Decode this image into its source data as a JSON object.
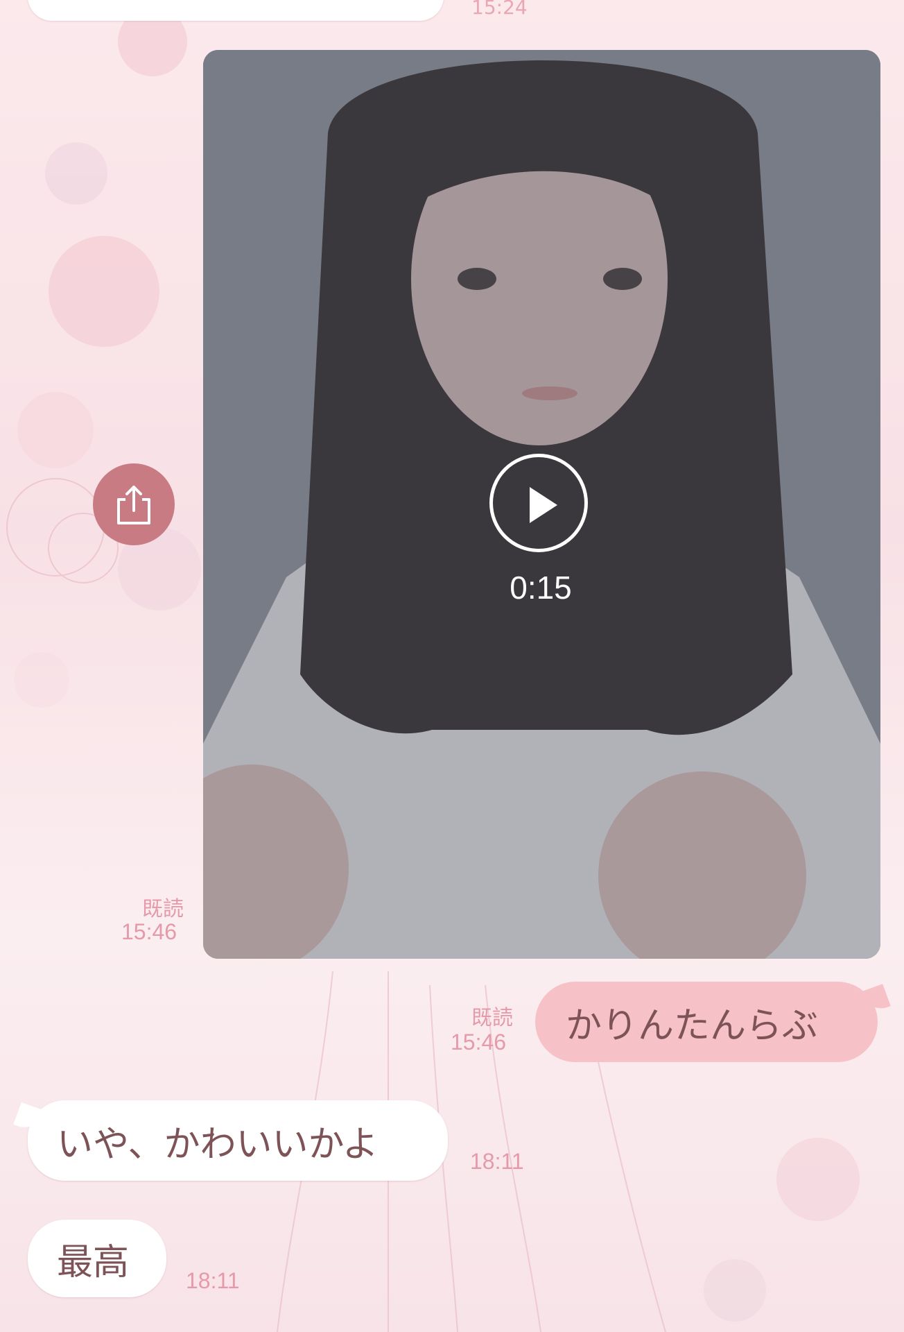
{
  "messages": {
    "top_time": "15:24",
    "video": {
      "duration": "0:15"
    },
    "read_label_1": "既読",
    "time_1": "15:46",
    "outgoing_1": "かりんたんらぶ",
    "read_label_2": "既読",
    "time_2": "15:46",
    "incoming_1": "いや、かわいいかよ",
    "time_3": "18:11",
    "incoming_2": "最高",
    "time_4": "18:11"
  },
  "colors": {
    "bubble_out": "#f6c2c8",
    "bubble_in": "#ffffff",
    "meta_text": "#e59aa9",
    "share_button": "#c97b83"
  },
  "icons": {
    "share": "share-icon",
    "play": "play-icon"
  }
}
